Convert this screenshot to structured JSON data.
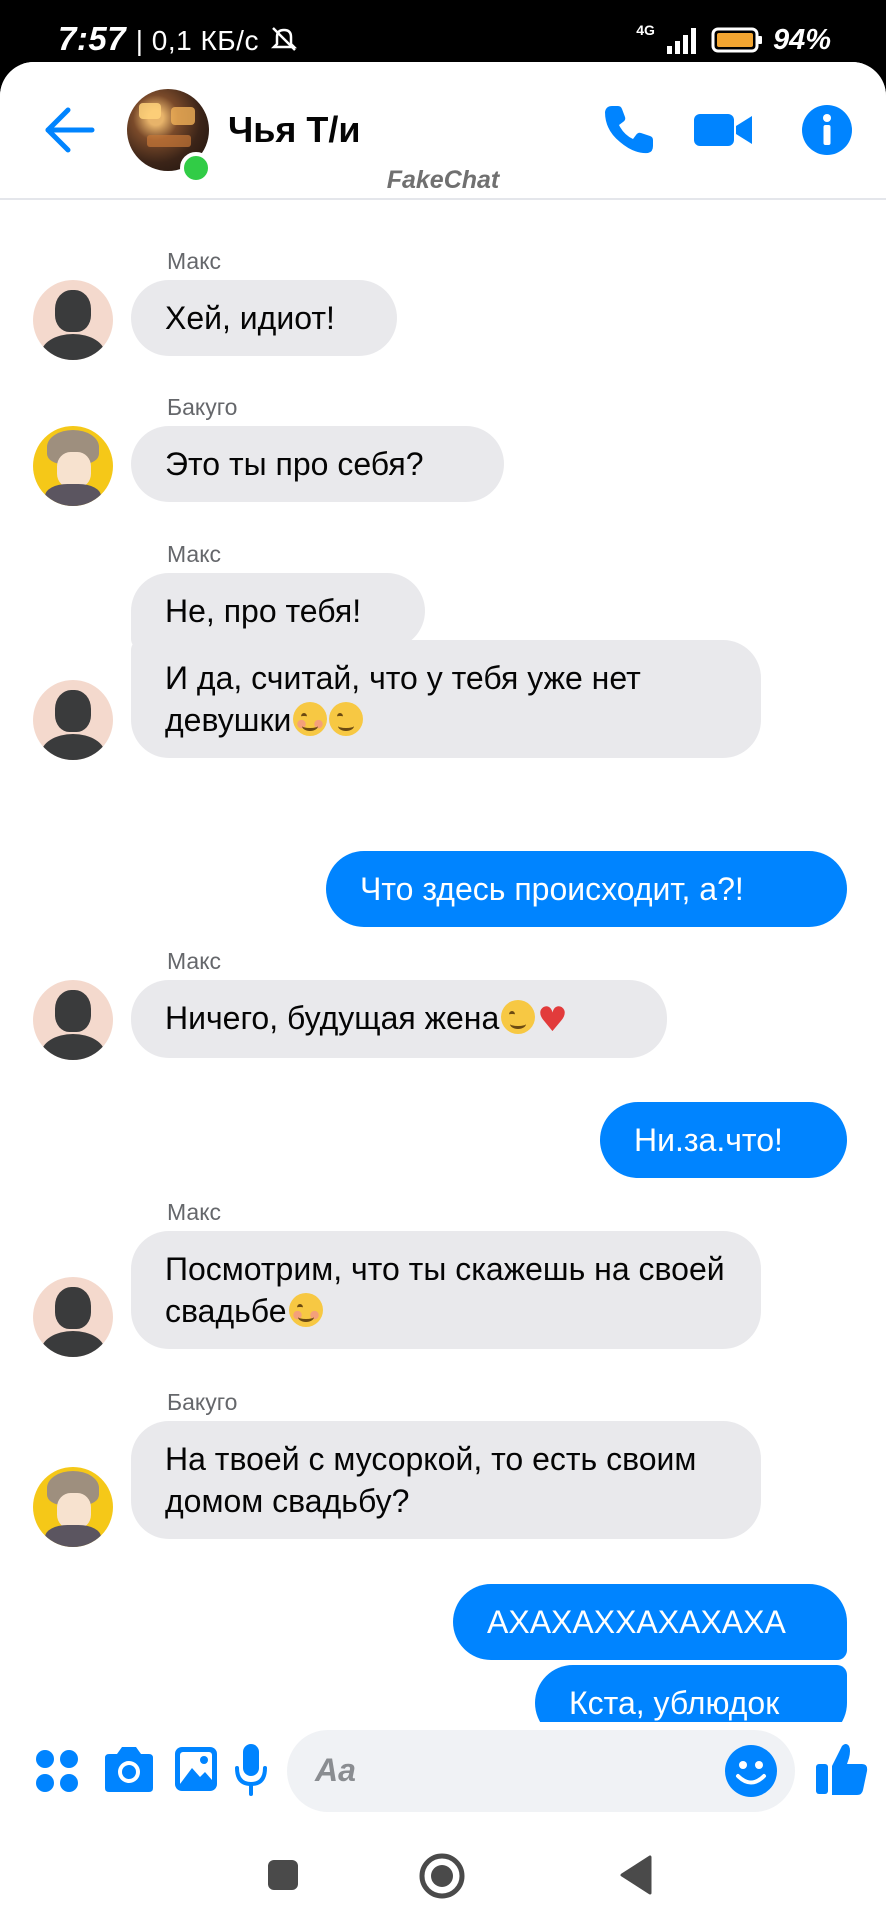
{
  "status_bar": {
    "time": "7:57",
    "speed": "| 0,1 КБ/с",
    "network": "4G",
    "battery": "94%"
  },
  "header": {
    "contact_name": "Чья Т/и",
    "watermark": "FakeChat"
  },
  "messages": [
    {
      "sender": "Макс",
      "text": "Хей, идиот!"
    },
    {
      "sender": "Бакуго",
      "text": "Это ты про себя?"
    },
    {
      "sender": "Макс",
      "text": "Не, про тебя!"
    },
    {
      "text": "И да, считай, что у тебя уже нет девушки",
      "emoji": "☺😉"
    },
    {
      "outgoing": true,
      "text": "Что здесь происходит, а?!"
    },
    {
      "sender": "Макс",
      "text": "Ничего, будущая жена",
      "emoji": "😉❤️"
    },
    {
      "outgoing": true,
      "text": "Ни.за.что!"
    },
    {
      "sender": "Макс",
      "text": "Посмотрим, что ты скажешь на своей свадьбе",
      "emoji": "☺"
    },
    {
      "sender": "Бакуго",
      "text": "На твоей с мусоркой, то есть своим домом свадьбу?"
    },
    {
      "outgoing": true,
      "text": "АХАХАХХАХАХАХА"
    },
    {
      "outgoing": true,
      "text": "Кста, ублюдок"
    }
  ],
  "composer": {
    "placeholder": "Aa"
  },
  "colors": {
    "accent": "#0084ff",
    "incoming_bubble": "#e9e9ec",
    "online": "#31cc46"
  }
}
